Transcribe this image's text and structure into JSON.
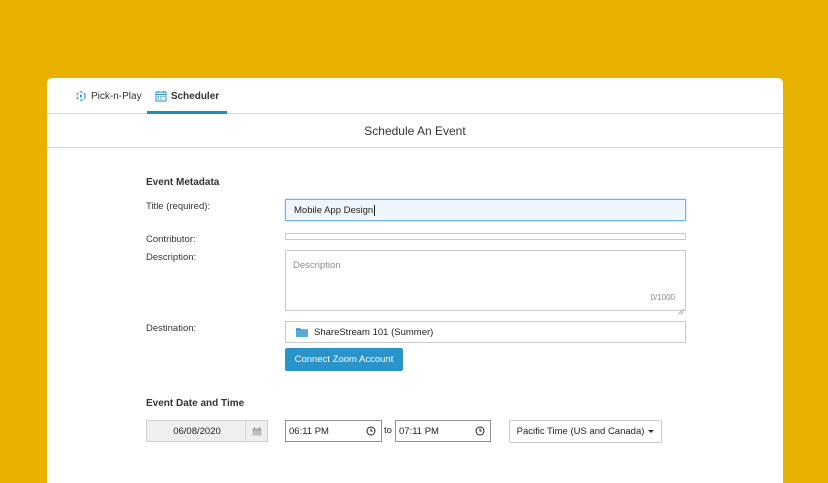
{
  "tabs": [
    {
      "label": "Pick-n-Play",
      "icon": "pick-n-play-icon"
    },
    {
      "label": "Scheduler",
      "icon": "calendar-icon",
      "active": true
    }
  ],
  "page": {
    "title": "Schedule An Event"
  },
  "metadata": {
    "heading": "Event Metadata",
    "title_label": "Title (required):",
    "title_value": "Mobile App Design",
    "contributor_label": "Contributor:",
    "contributor_value": "",
    "description_label": "Description:",
    "description_placeholder": "Description",
    "description_count": "0/1000",
    "destination_label": "Destination:",
    "destination_value": "ShareStream 101 (Summer)",
    "zoom_button": "Connect Zoom Account"
  },
  "datetime": {
    "heading": "Event Date and Time",
    "date": "06/08/2020",
    "start_time": "06:11 PM",
    "to_label": "to",
    "end_time": "07:11 PM",
    "timezone": "Pacific Time (US and Canada)"
  },
  "colors": {
    "background": "#E8B100",
    "accent": "#2a93c9",
    "tab_underline": "#1a8fb8"
  }
}
